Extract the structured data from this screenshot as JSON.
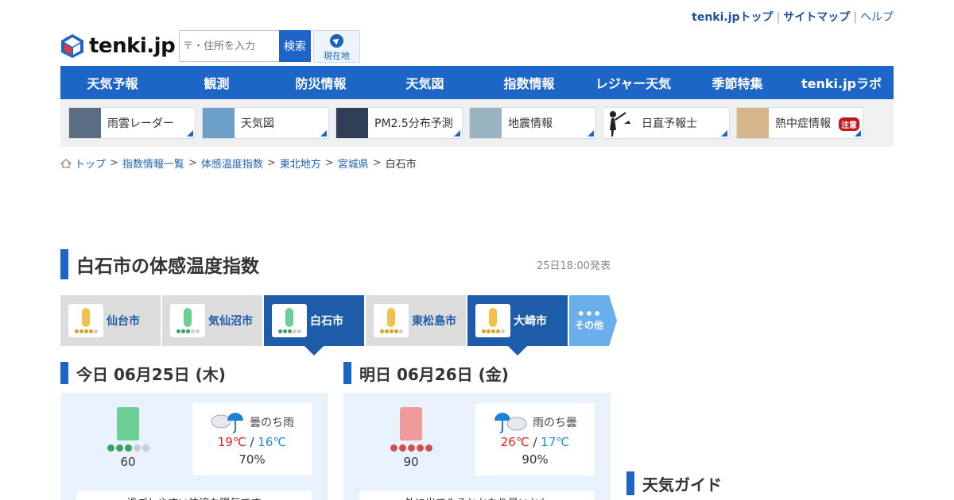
{
  "toplinks": {
    "top": "tenki.jpトップ",
    "sitemap": "サイトマップ",
    "help": "ヘルプ"
  },
  "logo": {
    "text": "tenki.jp"
  },
  "search": {
    "placeholder": "〒・住所を入力",
    "button": "検索",
    "geo": "現在地"
  },
  "nav": [
    "天気予報",
    "観測",
    "防災情報",
    "天気図",
    "指数情報",
    "レジャー天気",
    "季節特集",
    "tenki.jpラボ"
  ],
  "quick": [
    {
      "label": "雨雲レーダー"
    },
    {
      "label": "天気図"
    },
    {
      "label": "PM2.5分布予測"
    },
    {
      "label": "地震情報"
    },
    {
      "label": "日直予報士"
    },
    {
      "label": "熱中症情報",
      "badge": "注意"
    }
  ],
  "breadcrumb": [
    "トップ",
    "指数情報一覧",
    "体感温度指数",
    "東北地方",
    "宮城県",
    "白石市"
  ],
  "page": {
    "title": "白石市の体感温度指数",
    "published": "25日18:00発表"
  },
  "tabs": [
    {
      "name": "仙台市",
      "level": 4,
      "color": "#f3c14a",
      "selected": false
    },
    {
      "name": "気仙沼市",
      "level": 3,
      "color": "#6ccf93",
      "selected": false
    },
    {
      "name": "白石市",
      "level": 3,
      "color": "#6ccf93",
      "selected": true
    },
    {
      "name": "東松島市",
      "level": 4,
      "color": "#f3c14a",
      "selected": false
    },
    {
      "name": "大崎市",
      "level": 4,
      "color": "#f3c14a",
      "selected": true
    }
  ],
  "more": {
    "label": "その他"
  },
  "today": {
    "heading": "今日 06月25日 (木)",
    "index": "60",
    "level": 3,
    "color": "#6ccf93",
    "telop": "曇のち雨",
    "high": "19℃",
    "low": "16℃",
    "pop": "70%",
    "comment": "過ごしやすい快適な陽気です"
  },
  "tomorrow": {
    "heading": "明日 06月26日 (金)",
    "index": "90",
    "level": 5,
    "color": "#f19a9a",
    "telop": "雨のち曇",
    "high": "26℃",
    "low": "17℃",
    "pop": "90%",
    "comment": "外に出てみるとかなり暑いかも"
  },
  "guide": {
    "heading": "天気ガイド"
  },
  "colors": {
    "brand": "#1d66c8",
    "tabSelected": "#1c5ca8",
    "high": "#e5211d",
    "low": "#1e90d6"
  }
}
